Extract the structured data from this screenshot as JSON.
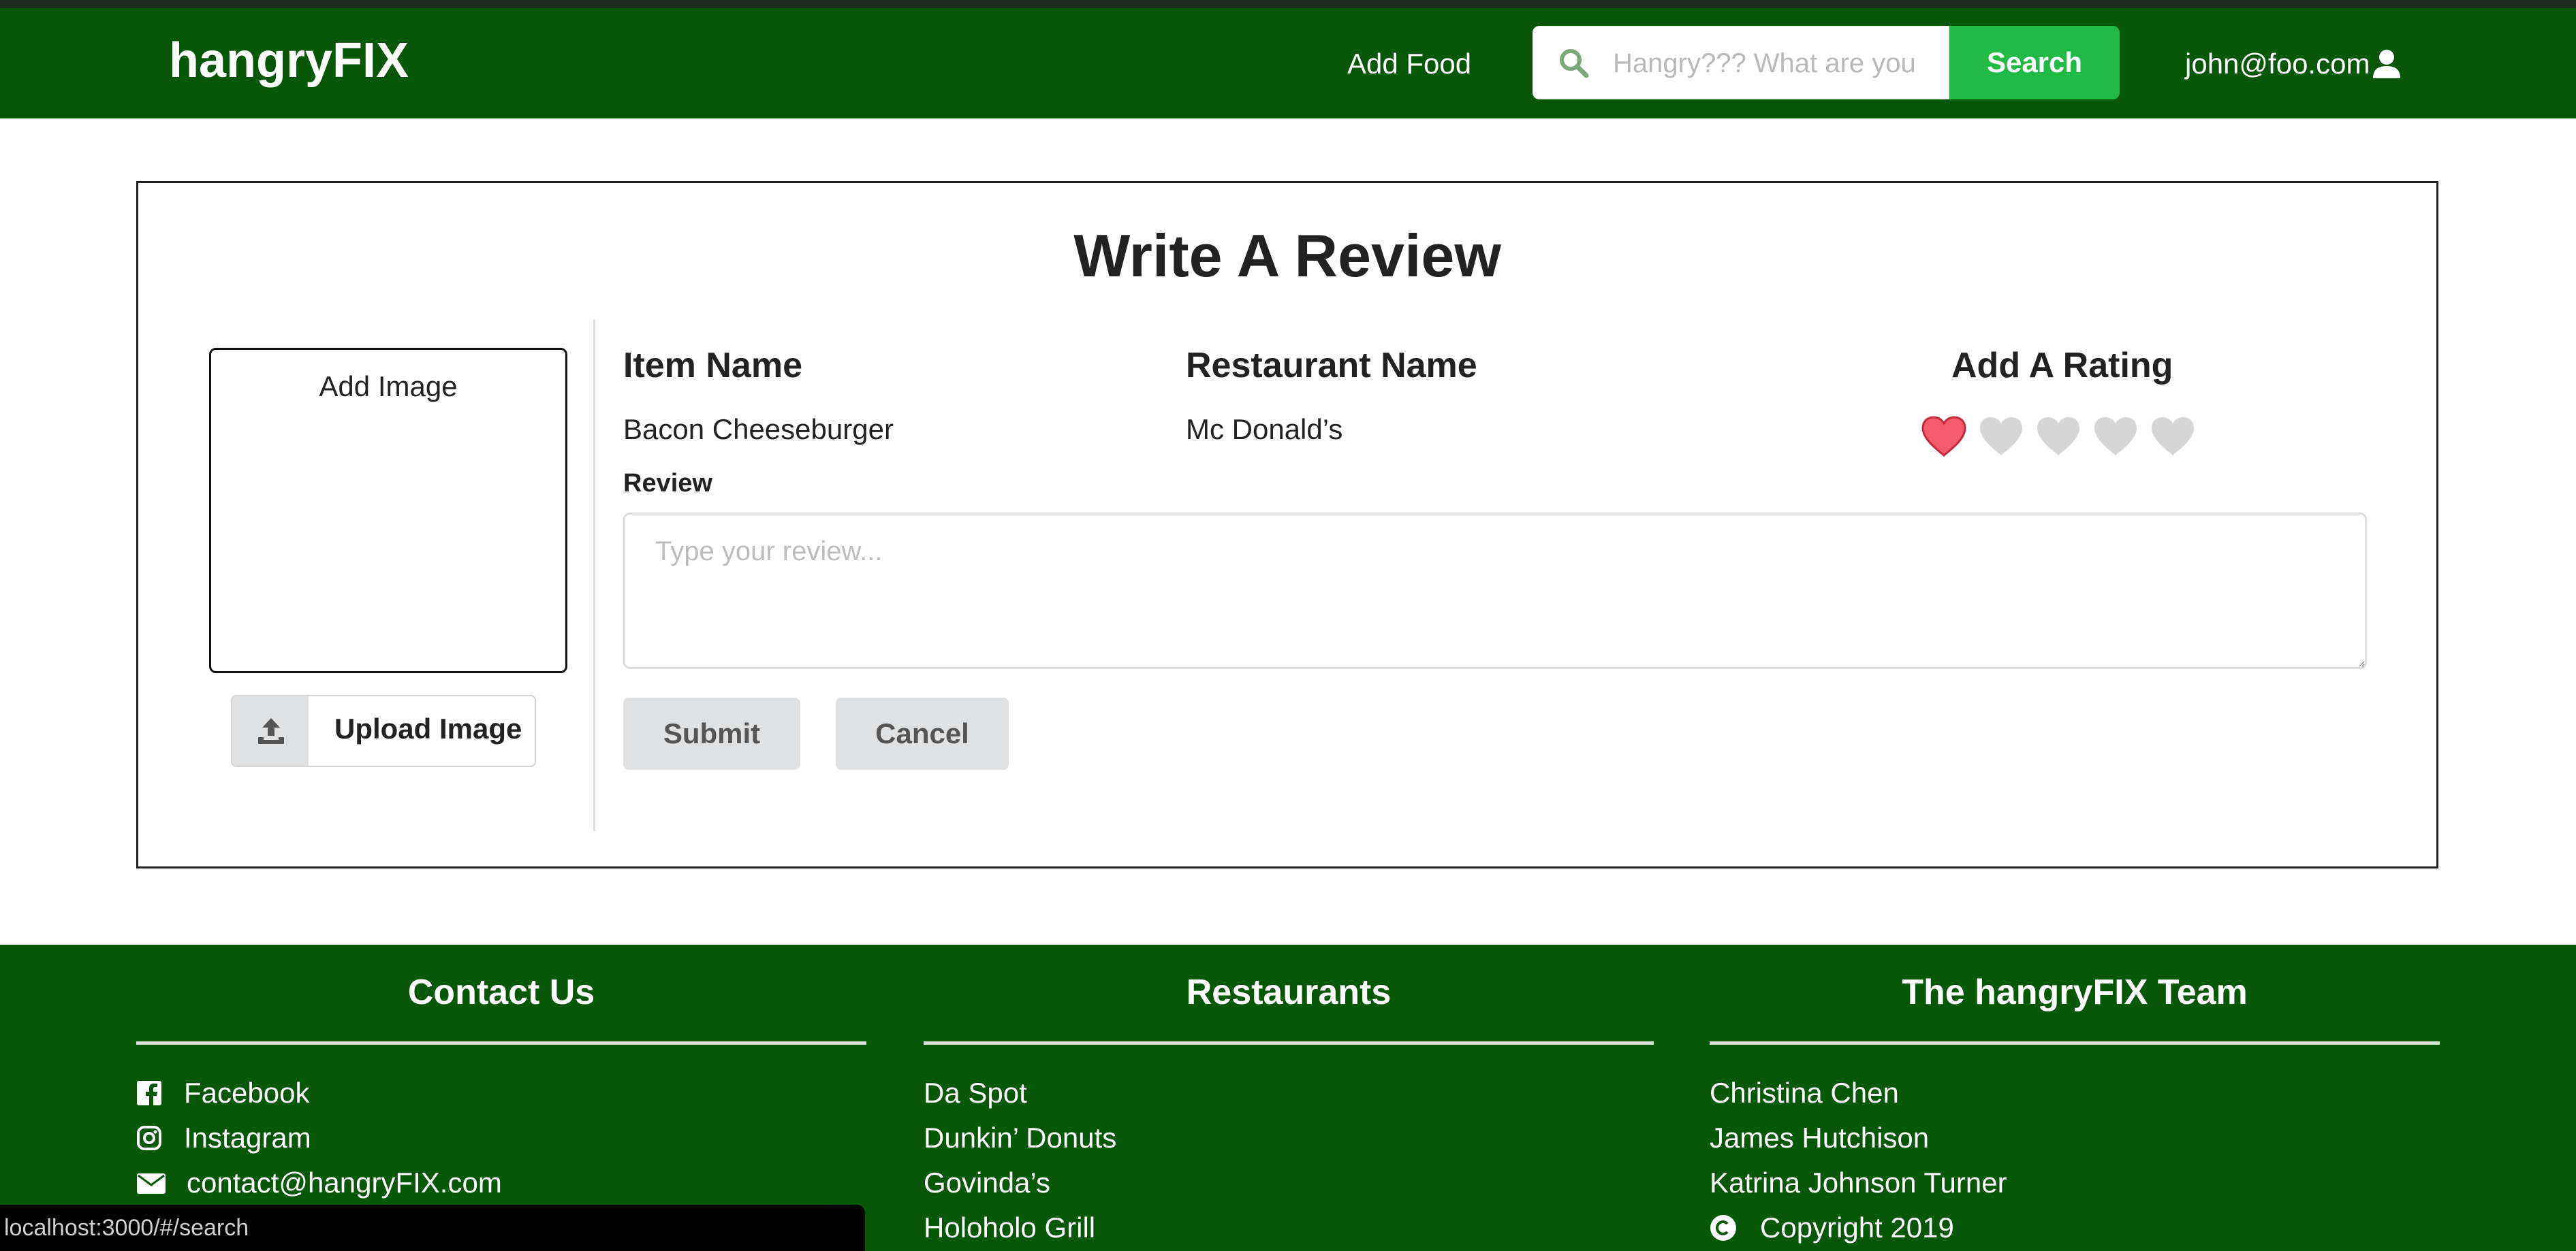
{
  "colors": {
    "nav_bg": "#065706",
    "search_button": "#21ba45",
    "heart_active": "#f25b6e",
    "heart_inactive": "#d6d6d6",
    "button_bg": "#e0e1e2"
  },
  "header": {
    "brand": "hangryFIX",
    "nav_link": "Add Food",
    "search": {
      "icon": "search-icon",
      "placeholder": "Hangry??? What are you",
      "button_label": "Search"
    },
    "user": {
      "email": "john@foo.com",
      "icon": "user-icon"
    }
  },
  "review": {
    "title": "Write A Review",
    "image_box_label": "Add Image",
    "upload_label": "Upload Image",
    "upload_icon": "upload-icon",
    "item_header": "Item Name",
    "item_value": "Bacon Cheeseburger",
    "restaurant_header": "Restaurant Name",
    "restaurant_value": "Mc Donald’s",
    "rating_header": "Add A Rating",
    "rating": {
      "value": 1,
      "max": 5,
      "icon": "heart-icon"
    },
    "review_label": "Review",
    "review_placeholder": "Type your review...",
    "submit_label": "Submit",
    "cancel_label": "Cancel"
  },
  "footer": {
    "contact": {
      "heading": "Contact Us",
      "items": [
        {
          "icon": "facebook-icon",
          "label": "Facebook"
        },
        {
          "icon": "instagram-icon",
          "label": "Instagram"
        },
        {
          "icon": "envelope-icon",
          "label": "contact@hangryFIX.com"
        }
      ]
    },
    "restaurants": {
      "heading": "Restaurants",
      "items": [
        "Da Spot",
        "Dunkin’ Donuts",
        "Govinda’s",
        "Holoholo Grill"
      ]
    },
    "team": {
      "heading": "The hangryFIX Team",
      "items": [
        "Christina Chen",
        "James Hutchison",
        "Katrina Johnson Turner"
      ],
      "copyright": {
        "icon": "copyright-icon",
        "label": "Copyright 2019"
      }
    }
  },
  "status_bar": {
    "url": "localhost:3000/#/search"
  }
}
